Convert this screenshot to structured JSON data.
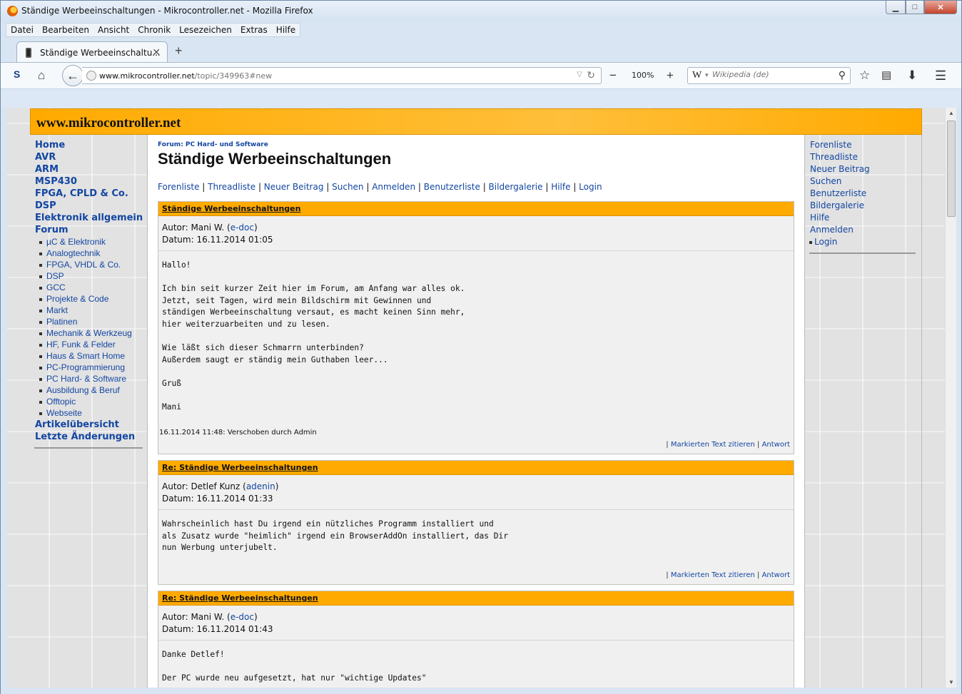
{
  "window": {
    "title": "Ständige Werbeeinschaltungen - Mikrocontroller.net - Mozilla Firefox",
    "controls": {
      "minimize": "▁",
      "maximize": "□",
      "close": "✕"
    }
  },
  "menubar": [
    "Datei",
    "Bearbeiten",
    "Ansicht",
    "Chronik",
    "Lesezeichen",
    "Extras",
    "Hilfe"
  ],
  "tab": {
    "label": "Ständige Werbeeinschaltu...",
    "close": "✕",
    "new_tab": "+"
  },
  "navbar": {
    "url_domain": "www.mikrocontroller.net",
    "url_path": "/topic/349963#new",
    "zoom": "100%",
    "zoom_minus": "−",
    "zoom_plus": "+",
    "search_engine_icon": "W",
    "search_placeholder": "Wikipedia (de)"
  },
  "site": {
    "logo": "www.mikrocontroller.net"
  },
  "leftnav": {
    "top": [
      "Home",
      "AVR",
      "ARM",
      "MSP430",
      "FPGA, CPLD & Co.",
      "DSP",
      "Elektronik allgemein",
      "Forum"
    ],
    "forums": [
      "µC & Elektronik",
      "Analogtechnik",
      "FPGA, VHDL & Co.",
      "DSP",
      "GCC",
      "Projekte & Code",
      "Markt",
      "Platinen",
      "Mechanik & Werkzeug",
      "HF, Funk & Felder",
      "Haus & Smart Home",
      "PC-Programmierung",
      "PC Hard- & Software",
      "Ausbildung & Beruf",
      "Offtopic",
      "Webseite"
    ],
    "bottom": [
      "Artikelübersicht",
      "Letzte Änderungen"
    ]
  },
  "main": {
    "breadcrumb": "Forum: PC Hard- und Software",
    "title": "Ständige Werbeeinschaltungen",
    "toplinks": [
      "Forenliste",
      "Threadliste",
      "Neuer Beitrag",
      "Suchen",
      "Anmelden",
      "Benutzerliste",
      "Bildergalerie",
      "Hilfe",
      "Login"
    ]
  },
  "posts": [
    {
      "subject": "Ständige Werbeeinschaltungen",
      "author_label": "Autor: Mani W.",
      "author_nick": "e-doc",
      "date": "Datum: 16.11.2014 01:05",
      "body": "Hallo!\n\nIch bin seit kurzer Zeit hier im Forum, am Anfang war alles ok.\nJetzt, seit Tagen, wird mein Bildschirm mit Gewinnen und\nständigen Werbeeinschaltung versaut, es macht keinen Sinn mehr,\nhier weiterzuarbeiten und zu lesen.\n\nWie läßt sich dieser Schmarrn unterbinden?\nAußerdem saugt er ständig mein Guthaben leer...\n\nGruß\n\nMani",
      "note": "16.11.2014 11:48: Verschoben durch Admin",
      "quote": "Markierten Text zitieren",
      "reply": "Antwort"
    },
    {
      "subject": "Re: Ständige Werbeeinschaltungen",
      "author_label": "Autor: Detlef Kunz",
      "author_nick": "adenin",
      "date": "Datum: 16.11.2014 01:33",
      "body": "Wahrscheinlich hast Du irgend ein nützliches Programm installiert und\nals Zusatz wurde \"heimlich\" irgend ein BrowserAddOn installiert, das Dir\nnun Werbung unterjubelt.",
      "quote": "Markierten Text zitieren",
      "reply": "Antwort"
    },
    {
      "subject": "Re: Ständige Werbeeinschaltungen",
      "author_label": "Autor: Mani W.",
      "author_nick": "e-doc",
      "date": "Datum: 16.11.2014 01:43",
      "body": "Danke Detlef!\n\nDer PC wurde neu aufgesetzt, hat nur \"wichtige Updates\""
    }
  ],
  "rightnav": {
    "links": [
      "Forenliste",
      "Threadliste",
      "Neuer Beitrag",
      "Suchen",
      "Benutzerliste",
      "Bildergalerie",
      "Hilfe",
      "Anmelden"
    ],
    "sub": "Login"
  }
}
